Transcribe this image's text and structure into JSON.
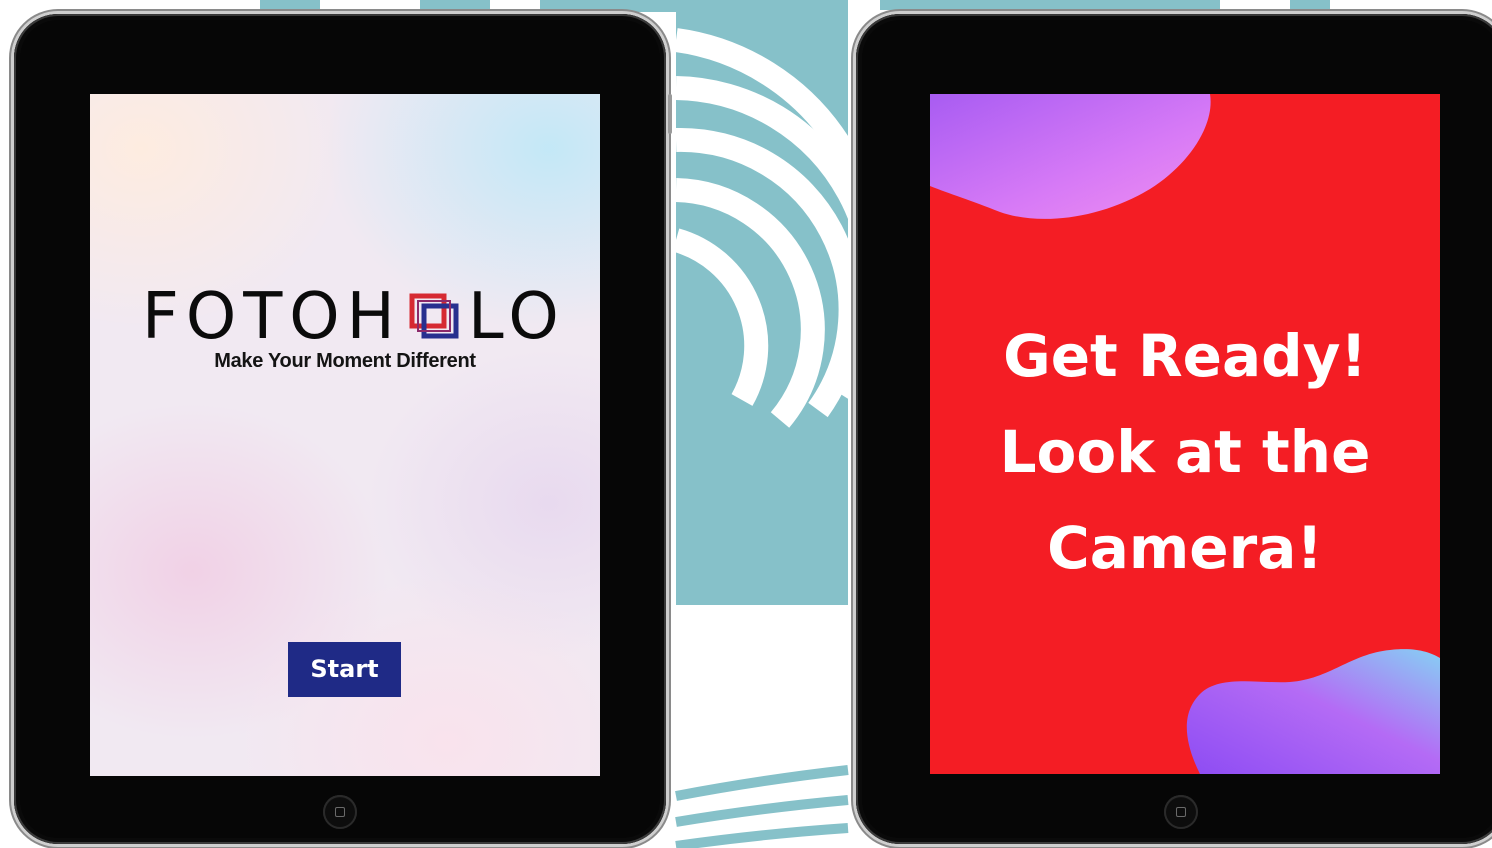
{
  "left_tablet": {
    "logo": {
      "text_left": "FOTOH",
      "text_right": "LO",
      "tagline": "Make Your  Moment Different"
    },
    "start_button_label": "Start"
  },
  "right_tablet": {
    "message_lines": [
      "Get Ready!",
      "Look at the",
      "Camera!"
    ]
  },
  "colors": {
    "start_button": "#1f2a86",
    "ready_screen": "#f41d24",
    "blob_gradient": [
      "#a85cf2",
      "#e27df5",
      "#7fc8f2"
    ],
    "backdrop_teal": "#86c1c9"
  },
  "icons": {
    "home_button": "home-button-icon",
    "logo_mark": "overlapping-squares-icon"
  }
}
